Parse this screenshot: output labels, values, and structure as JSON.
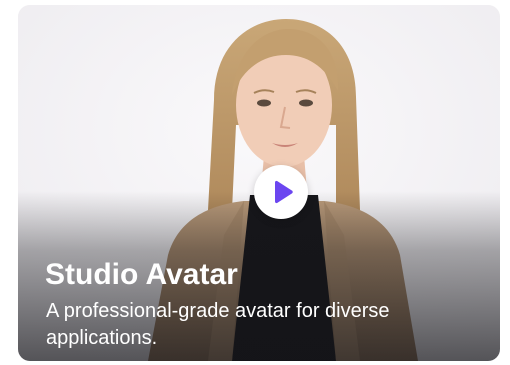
{
  "card": {
    "title": "Studio Avatar",
    "description": "A professional-grade avatar for diverse applications.",
    "play_icon": "play-icon",
    "colors": {
      "play_accent": "#6b46f0",
      "background": "#f4f3f6",
      "text": "#ffffff"
    }
  }
}
